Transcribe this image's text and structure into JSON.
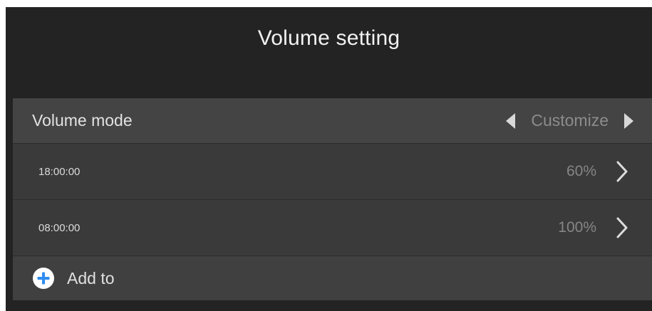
{
  "header": {
    "title": "Volume setting"
  },
  "volume_mode": {
    "label": "Volume mode",
    "value": "Customize",
    "prev_icon": "triangle-left-icon",
    "next_icon": "triangle-right-icon"
  },
  "schedule": [
    {
      "time": "18:00:00",
      "volume": "60%"
    },
    {
      "time": "08:00:00",
      "volume": "100%"
    }
  ],
  "add": {
    "label": "Add to",
    "icon": "plus-circle-icon"
  },
  "colors": {
    "background": "#232323",
    "panel": "#3a3a3a",
    "accent": "#2f8cf0"
  }
}
